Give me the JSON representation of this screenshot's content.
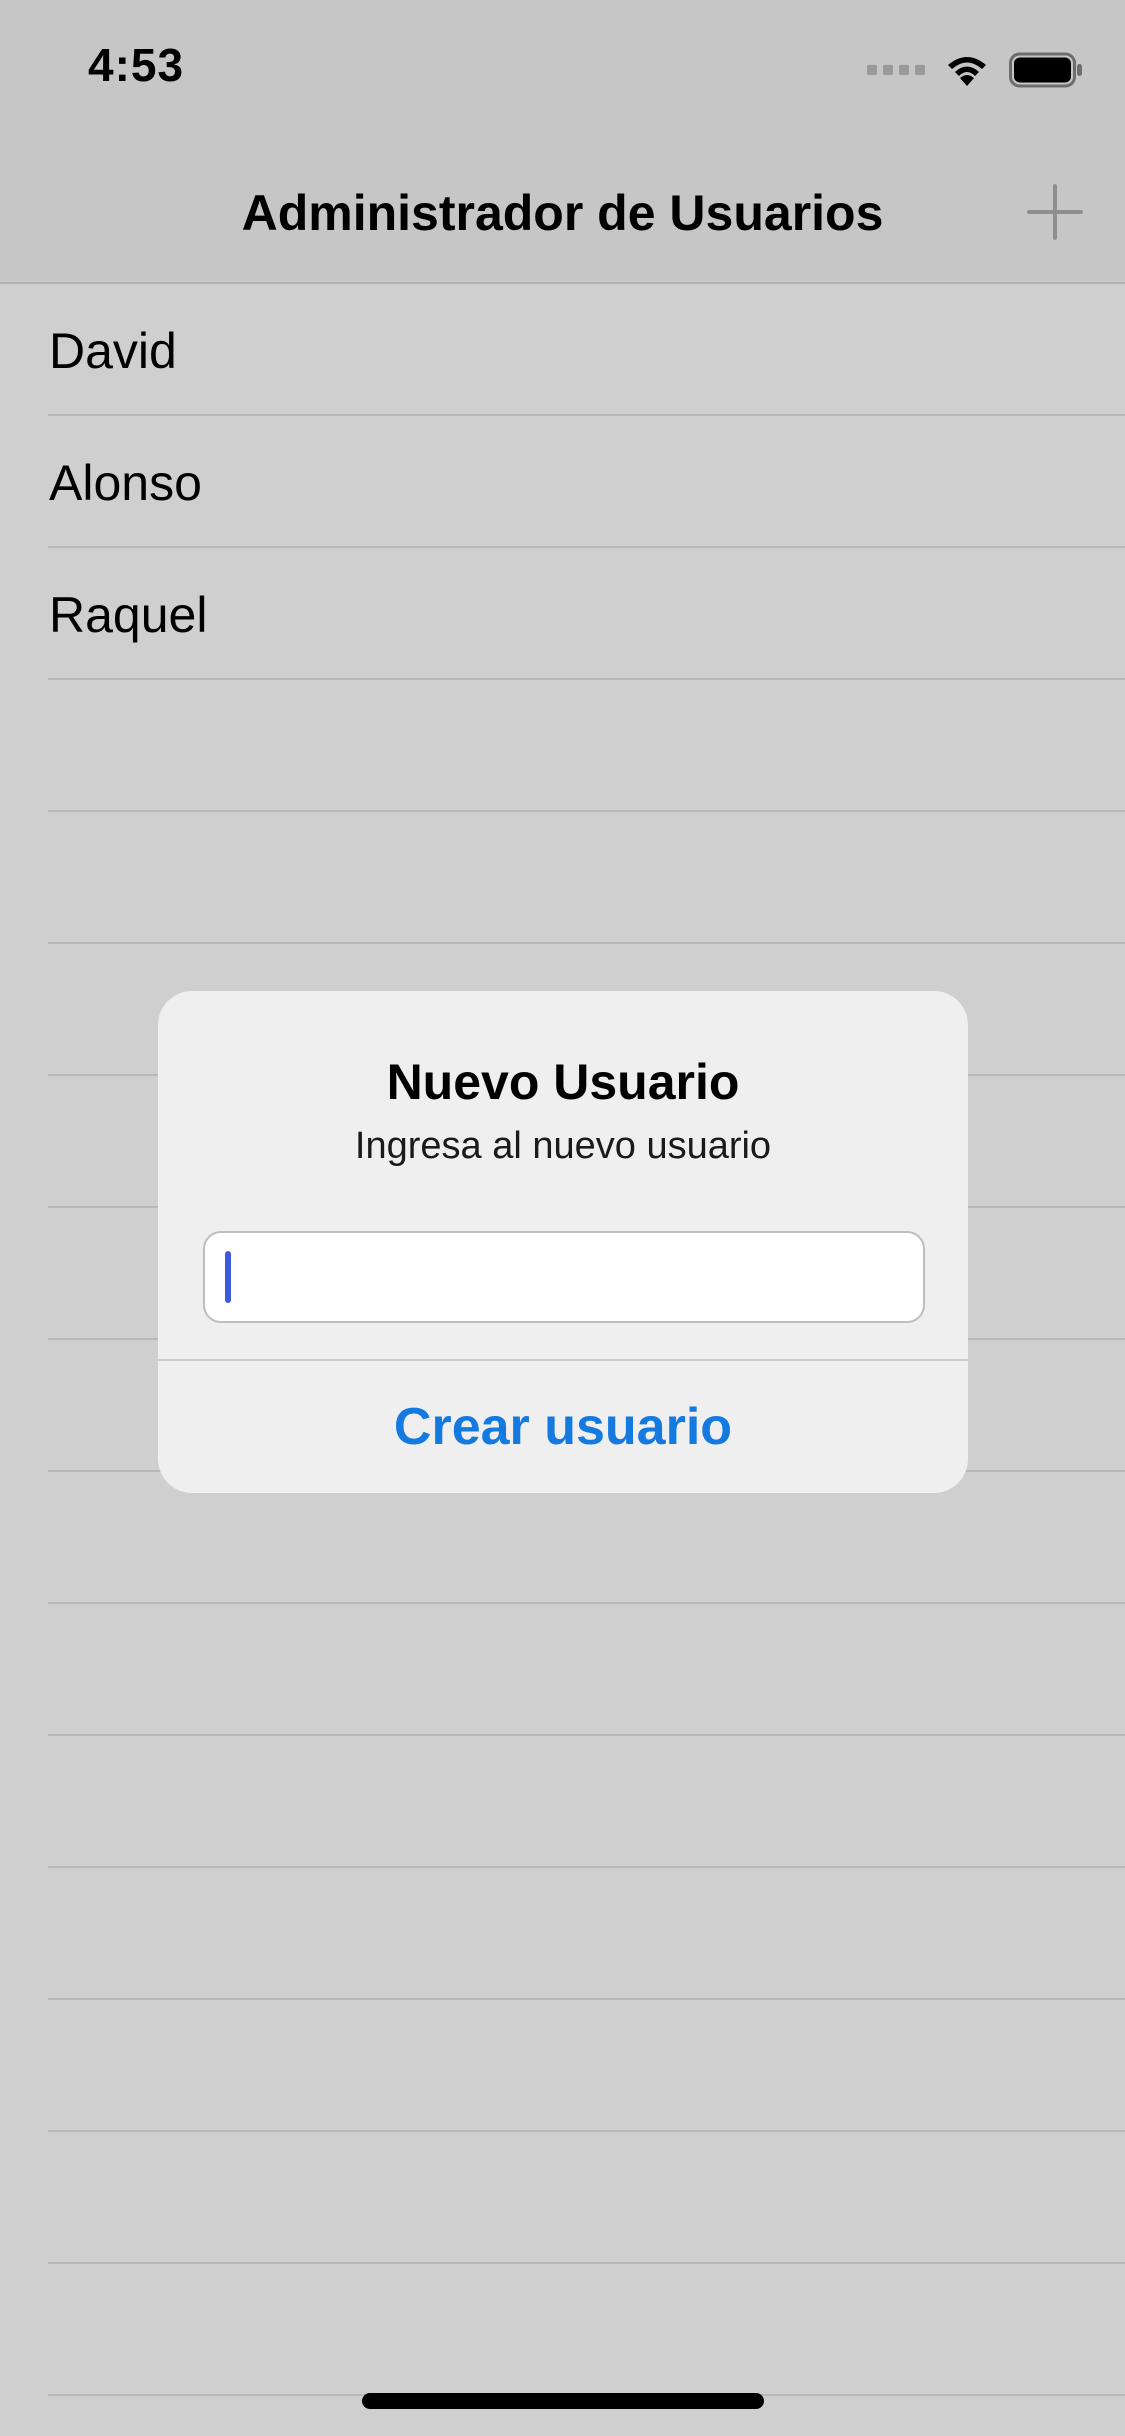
{
  "status_bar": {
    "time": "4:53",
    "icons": [
      "cellular-signal-icon",
      "wifi-icon",
      "battery-icon"
    ]
  },
  "nav": {
    "title": "Administrador de Usuarios",
    "add_icon": "plus-icon"
  },
  "list": {
    "items": [
      "David",
      "Alonso",
      "Raquel",
      "",
      "",
      "",
      "",
      "",
      "",
      "",
      "",
      "",
      "",
      "",
      "",
      "",
      ""
    ]
  },
  "alert": {
    "title": "Nuevo Usuario",
    "message": "Ingresa al nuevo usuario",
    "input_value": "",
    "action_label": "Crear usuario"
  },
  "colors": {
    "background": "#cfcfcf",
    "alert_background": "#efefef",
    "action_blue": "#147ae0",
    "caret_blue": "#3b5bdb"
  }
}
